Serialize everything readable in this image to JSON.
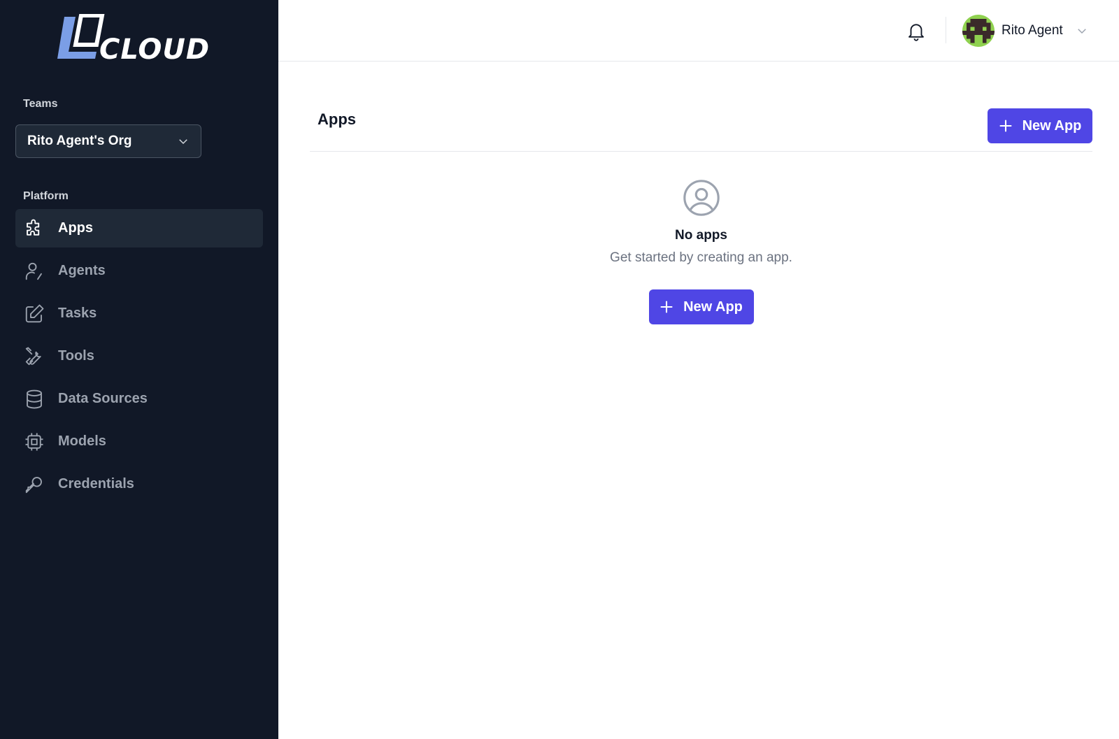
{
  "sidebar": {
    "teams_label": "Teams",
    "team_selected": "Rito Agent's Org",
    "platform_label": "Platform",
    "items": [
      {
        "label": "Apps",
        "icon": "puzzle-icon",
        "active": true
      },
      {
        "label": "Agents",
        "icon": "user-pen-icon",
        "active": false
      },
      {
        "label": "Tasks",
        "icon": "pencil-square-icon",
        "active": false
      },
      {
        "label": "Tools",
        "icon": "tools-icon",
        "active": false
      },
      {
        "label": "Data Sources",
        "icon": "database-icon",
        "active": false
      },
      {
        "label": "Models",
        "icon": "chip-icon",
        "active": false
      },
      {
        "label": "Credentials",
        "icon": "key-icon",
        "active": false
      }
    ]
  },
  "header": {
    "user_name": "Rito Agent"
  },
  "main": {
    "title": "Apps",
    "new_app_label": "New App",
    "empty_title": "No apps",
    "empty_subtitle": "Get started by creating an app.",
    "empty_button_label": "New App"
  },
  "colors": {
    "sidebar_bg": "#111827",
    "sidebar_active": "#1f2937",
    "primary": "#4f46e5",
    "logo_accent": "#7b9ee6"
  }
}
